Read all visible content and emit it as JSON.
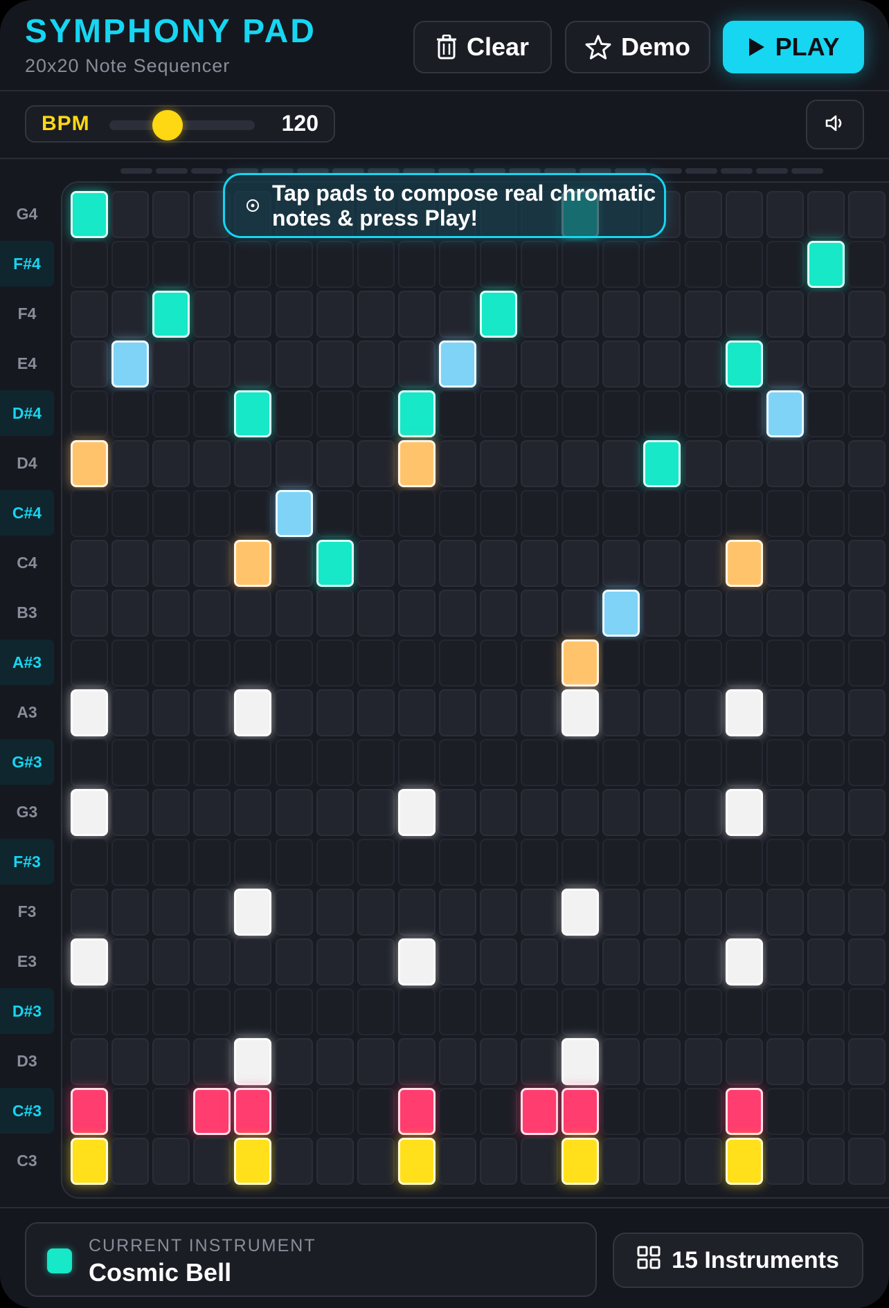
{
  "header": {
    "title": "SYMPHONY PAD",
    "subtitle": "20x20 Note Sequencer",
    "clear_label": "Clear",
    "demo_label": "Demo",
    "play_label": "PLAY"
  },
  "controls": {
    "bpm_label": "BPM",
    "bpm_value": "120",
    "bpm_slider_fraction": 0.4
  },
  "tooltip": {
    "text": "Tap pads to compose real chromatic notes & press Play!"
  },
  "grid": {
    "columns": 20,
    "notes": [
      "G4",
      "F#4",
      "F4",
      "E4",
      "D#4",
      "D4",
      "C#4",
      "C4",
      "B3",
      "A#3",
      "A3",
      "G#3",
      "G3",
      "F#3",
      "F3",
      "E3",
      "D#3",
      "D3",
      "C#3",
      "C3"
    ],
    "colors": {
      "teal": "#16e8c8",
      "blue": "#7fd3f7",
      "orange": "#ffc46b",
      "white": "#f2f2f2",
      "pink": "#ff3d6e",
      "yellow": "#ffe01a"
    },
    "active": [
      {
        "row": "G4",
        "cols": [
          0,
          12
        ],
        "color": "teal"
      },
      {
        "row": "F#4",
        "cols": [
          18
        ],
        "color": "teal"
      },
      {
        "row": "F4",
        "cols": [
          2,
          10
        ],
        "color": "teal"
      },
      {
        "row": "E4",
        "cols": [
          1,
          9
        ],
        "color": "blue"
      },
      {
        "row": "E4",
        "cols": [
          16
        ],
        "color": "teal"
      },
      {
        "row": "D#4",
        "cols": [
          4,
          8
        ],
        "color": "teal"
      },
      {
        "row": "D#4",
        "cols": [
          17
        ],
        "color": "blue"
      },
      {
        "row": "D4",
        "cols": [
          0,
          8
        ],
        "color": "orange"
      },
      {
        "row": "D4",
        "cols": [
          14
        ],
        "color": "teal"
      },
      {
        "row": "C#4",
        "cols": [
          5
        ],
        "color": "blue"
      },
      {
        "row": "C4",
        "cols": [
          4,
          16
        ],
        "color": "orange"
      },
      {
        "row": "C4",
        "cols": [
          6
        ],
        "color": "teal"
      },
      {
        "row": "B3",
        "cols": [
          13
        ],
        "color": "blue"
      },
      {
        "row": "A#3",
        "cols": [
          12
        ],
        "color": "orange"
      },
      {
        "row": "A3",
        "cols": [
          0,
          4,
          12,
          16
        ],
        "color": "white"
      },
      {
        "row": "G3",
        "cols": [
          0,
          8,
          16
        ],
        "color": "white"
      },
      {
        "row": "F3",
        "cols": [
          4,
          12
        ],
        "color": "white"
      },
      {
        "row": "E3",
        "cols": [
          0,
          8,
          16
        ],
        "color": "white"
      },
      {
        "row": "D3",
        "cols": [
          4,
          12
        ],
        "color": "white"
      },
      {
        "row": "C#3",
        "cols": [
          0,
          3,
          4,
          8,
          11,
          12,
          16
        ],
        "color": "pink"
      },
      {
        "row": "C3",
        "cols": [
          0,
          4,
          8,
          12,
          16
        ],
        "color": "yellow"
      }
    ]
  },
  "footer": {
    "caption": "CURRENT INSTRUMENT",
    "instrument": "Cosmic Bell",
    "instrument_color": "#16e8c8",
    "instruments_button": "15 Instruments"
  }
}
